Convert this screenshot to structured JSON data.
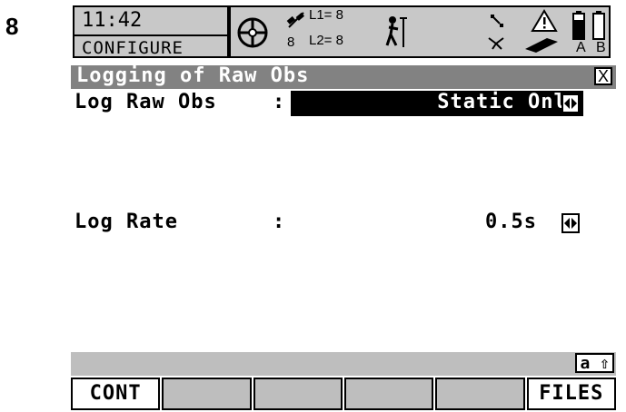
{
  "step_number": "8",
  "status": {
    "time": "11:42",
    "mode": "CONFIGURE",
    "l1": "L1= 8",
    "l2": "L2= 8",
    "sat_count": "8",
    "battery_a": "A",
    "battery_b": "B"
  },
  "dialog": {
    "title": "Logging of Raw Obs",
    "close": "X"
  },
  "fields": {
    "log_raw_obs": {
      "label": "Log Raw Obs",
      "colon": ":",
      "value": "Static Only"
    },
    "log_rate": {
      "label": "Log Rate",
      "colon": ":",
      "value": "0.5s"
    }
  },
  "input_mode": "a ⇧",
  "softkeys": [
    "CONT",
    "",
    "",
    "",
    "",
    "FILES"
  ]
}
